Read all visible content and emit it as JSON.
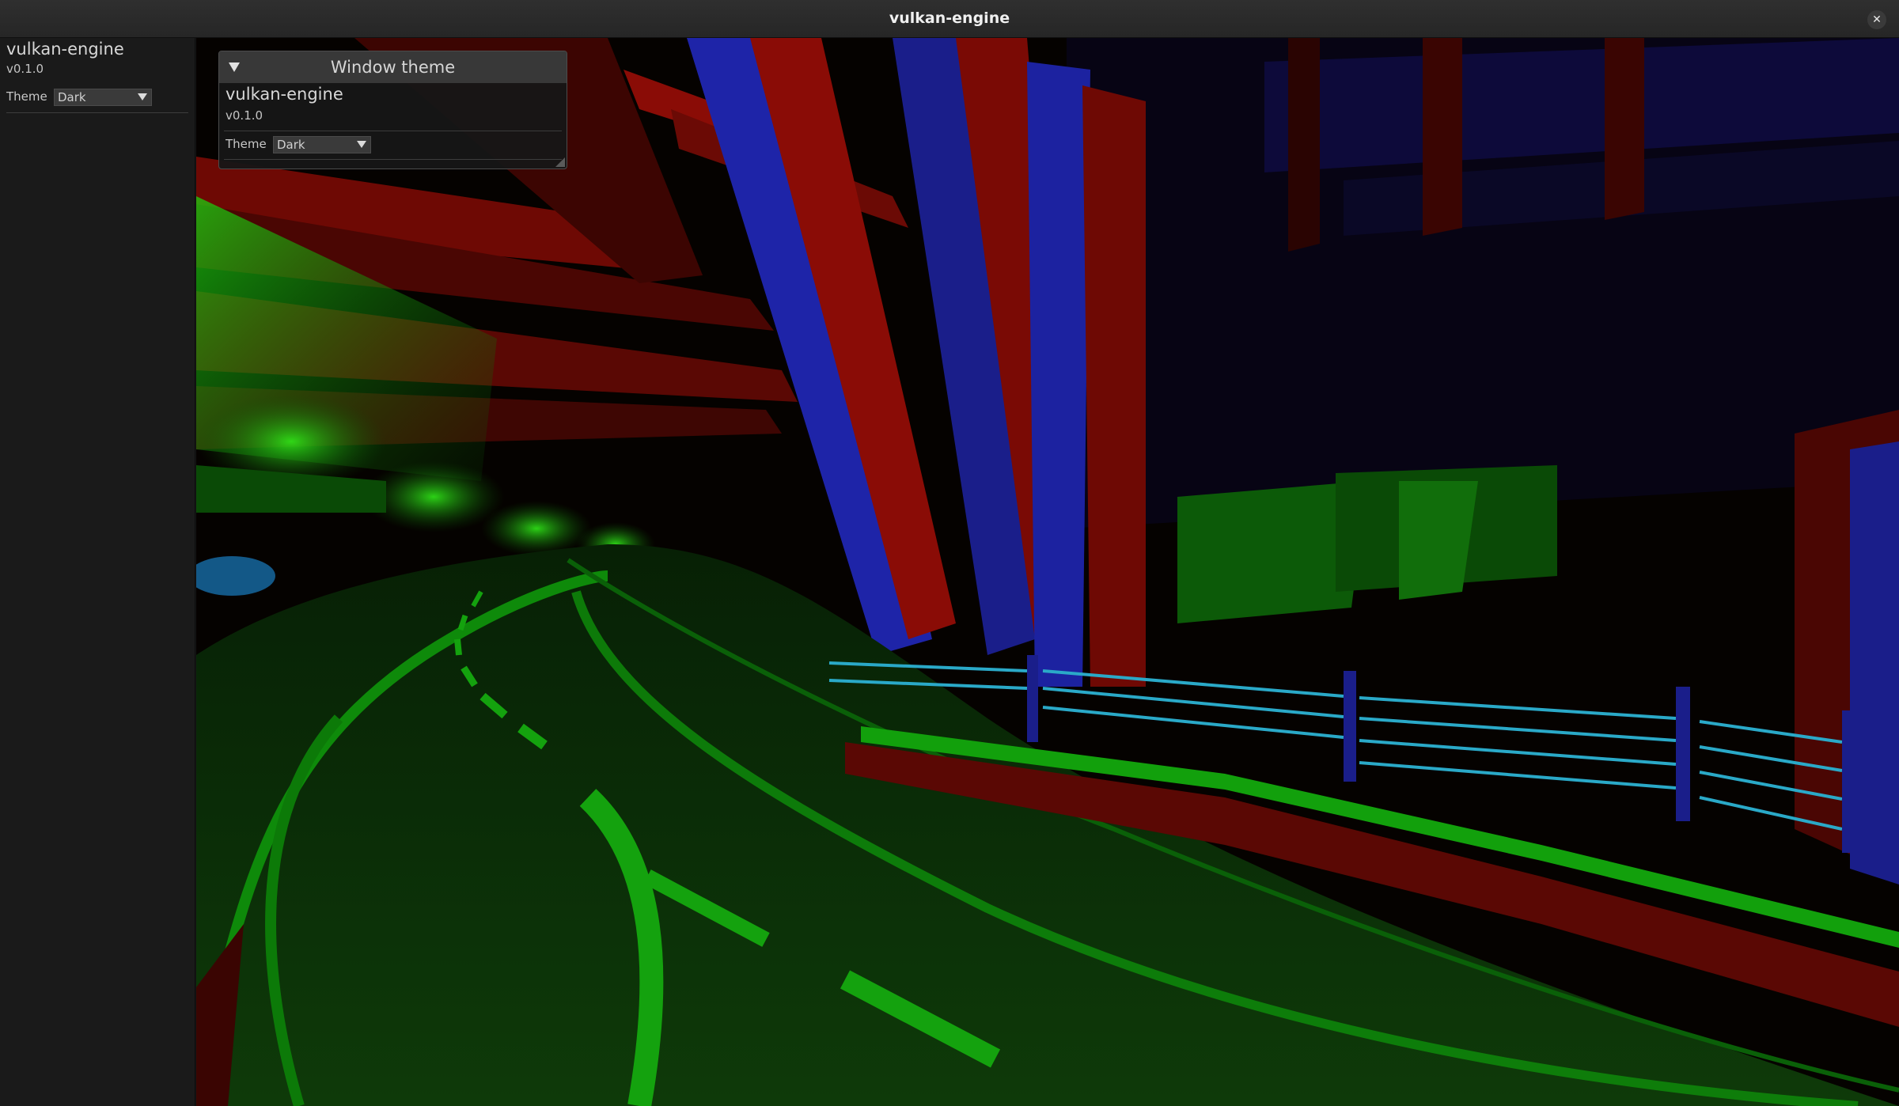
{
  "window": {
    "title": "vulkan-engine",
    "close_glyph": "✕"
  },
  "sidebar": {
    "app_name": "vulkan-engine",
    "version": "v0.1.0",
    "theme_label": "Theme",
    "theme_value": "Dark"
  },
  "theme_window": {
    "title": "Window theme",
    "app_name": "vulkan-engine",
    "version": "v0.1.0",
    "theme_label": "Theme",
    "theme_value": "Dark"
  },
  "viewport": {
    "description_icon": "3d-scene-viewport",
    "colors": {
      "background": "#050200",
      "structure_red": "#8a0c06",
      "structure_blue": "#1e24a8",
      "road_green": "#0c3608",
      "lane_marking": "#14a20e",
      "railing_cyan": "#2aa9c8"
    }
  }
}
